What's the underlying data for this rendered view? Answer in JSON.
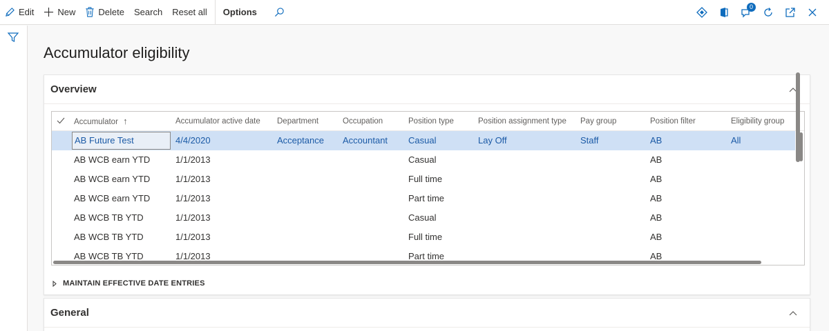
{
  "toolbar": {
    "edit_label": "Edit",
    "new_label": "New",
    "delete_label": "Delete",
    "search_label": "Search",
    "reset_all_label": "Reset all",
    "options_label": "Options",
    "notification_count": "0"
  },
  "page": {
    "title": "Accumulator eligibility"
  },
  "overview": {
    "title": "Overview",
    "columns": [
      "Accumulator",
      "Accumulator active date",
      "Department",
      "Occupation",
      "Position type",
      "Position assignment type",
      "Pay group",
      "Position filter",
      "Eligibility group"
    ],
    "sort_indicator": "↑",
    "rows": [
      {
        "accumulator": "AB Future Test",
        "active_date": "4/4/2020",
        "department": "Acceptance",
        "occupation": "Accountant",
        "position_type": "Casual",
        "assignment_type": "Lay Off",
        "pay_group": "Staff",
        "position_filter": "AB",
        "eligibility_group": "All"
      },
      {
        "accumulator": "AB WCB earn YTD",
        "active_date": "1/1/2013",
        "department": "",
        "occupation": "",
        "position_type": "Casual",
        "assignment_type": "",
        "pay_group": "",
        "position_filter": "AB",
        "eligibility_group": ""
      },
      {
        "accumulator": "AB WCB earn YTD",
        "active_date": "1/1/2013",
        "department": "",
        "occupation": "",
        "position_type": "Full time",
        "assignment_type": "",
        "pay_group": "",
        "position_filter": "AB",
        "eligibility_group": ""
      },
      {
        "accumulator": "AB WCB earn YTD",
        "active_date": "1/1/2013",
        "department": "",
        "occupation": "",
        "position_type": "Part time",
        "assignment_type": "",
        "pay_group": "",
        "position_filter": "AB",
        "eligibility_group": ""
      },
      {
        "accumulator": "AB WCB TB YTD",
        "active_date": "1/1/2013",
        "department": "",
        "occupation": "",
        "position_type": "Casual",
        "assignment_type": "",
        "pay_group": "",
        "position_filter": "AB",
        "eligibility_group": ""
      },
      {
        "accumulator": "AB WCB TB YTD",
        "active_date": "1/1/2013",
        "department": "",
        "occupation": "",
        "position_type": "Full time",
        "assignment_type": "",
        "pay_group": "",
        "position_filter": "AB",
        "eligibility_group": ""
      },
      {
        "accumulator": "AB WCB TB YTD",
        "active_date": "1/1/2013",
        "department": "",
        "occupation": "",
        "position_type": "Part time",
        "assignment_type": "",
        "pay_group": "",
        "position_filter": "AB",
        "eligibility_group": ""
      }
    ],
    "subsection_label": "MAINTAIN EFFECTIVE DATE ENTRIES"
  },
  "general": {
    "title": "General"
  },
  "colors": {
    "accent": "#0f6cbd",
    "selected_row": "#cfe0f5",
    "selected_text": "#1b5aa6"
  }
}
